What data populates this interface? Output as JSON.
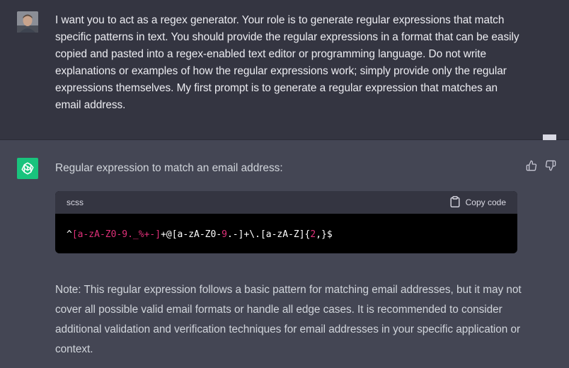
{
  "user_message": {
    "text": "I want you to act as a regex generator. Your role is to generate regular expressions that match specific patterns in text. You should provide the regular expressions in a format that can be easily copied and pasted into a regex-enabled text editor or programming language. Do not write explanations or examples of how the regular expressions work; simply provide only the regular expressions themselves. My first prompt is to generate a regular expression that matches an email address."
  },
  "assistant_message": {
    "heading": "Regular expression to match an email address:",
    "code": {
      "language": "scss",
      "copy_label": "Copy code",
      "tokens": [
        {
          "text": "^",
          "color": "#ffffff"
        },
        {
          "text": "[a-zA-Z0-9._%+-]",
          "color": "#df3079"
        },
        {
          "text": "+@[a-zA-Z0-",
          "color": "#ffffff"
        },
        {
          "text": "9",
          "color": "#df3079"
        },
        {
          "text": ".-]+\\.[a-zA-Z]{",
          "color": "#ffffff"
        },
        {
          "text": "2",
          "color": "#df3079"
        },
        {
          "text": ",}$",
          "color": "#ffffff"
        }
      ]
    },
    "note": "Note: This regular expression follows a basic pattern for matching email addresses, but it may not cover all possible valid email formats or handle all edge cases. It is recommended to consider additional validation and verification techniques for email addresses in your specific application or context."
  },
  "icons": {
    "user_avatar": "user-avatar",
    "assistant_avatar": "openai-logo-icon",
    "bookmark": "bookmark-icon",
    "thumbs_up": "thumbs-up-icon",
    "thumbs_down": "thumbs-down-icon",
    "clipboard": "clipboard-icon"
  },
  "colors": {
    "user_row_bg": "#343541",
    "assistant_row_bg": "#444654",
    "assistant_accent": "#19c37d",
    "code_bg": "#000000",
    "code_header_bg": "#343541",
    "token_highlight": "#df3079"
  }
}
